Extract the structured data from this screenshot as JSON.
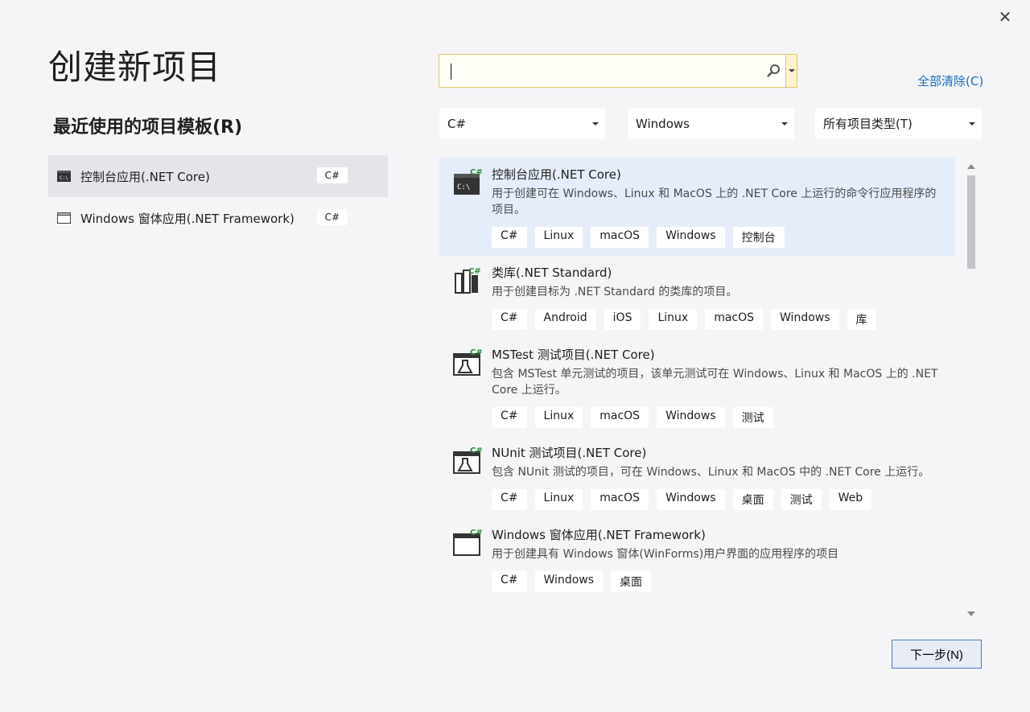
{
  "dialog": {
    "title": "创建新项目",
    "close_label": "✕"
  },
  "recent": {
    "title": "最近使用的项目模板(R)",
    "items": [
      {
        "label": "控制台应用(.NET Core)",
        "lang": "C#"
      },
      {
        "label": "Windows 窗体应用(.NET Framework)",
        "lang": "C#"
      }
    ]
  },
  "search": {
    "value": "",
    "placeholder": ""
  },
  "clear_all_label": "全部清除(C)",
  "filters": {
    "language": "C#",
    "platform": "Windows",
    "project_type": "所有项目类型(T)"
  },
  "templates": [
    {
      "name": "控制台应用(.NET Core)",
      "description": "用于创建可在 Windows、Linux 和 MacOS 上的 .NET Core 上运行的命令行应用程序的项目。",
      "tags": [
        "C#",
        "Linux",
        "macOS",
        "Windows",
        "控制台"
      ]
    },
    {
      "name": "类库(.NET Standard)",
      "description": "用于创建目标为 .NET Standard 的类库的项目。",
      "tags": [
        "C#",
        "Android",
        "iOS",
        "Linux",
        "macOS",
        "Windows",
        "库"
      ]
    },
    {
      "name": "MSTest 测试项目(.NET Core)",
      "description": "包含 MSTest 单元测试的项目，该单元测试可在 Windows、Linux 和 MacOS 上的 .NET Core 上运行。",
      "tags": [
        "C#",
        "Linux",
        "macOS",
        "Windows",
        "测试"
      ]
    },
    {
      "name": "NUnit 测试项目(.NET Core)",
      "description": "包含 NUnit 测试的项目，可在 Windows、Linux 和 MacOS 中的 .NET Core 上运行。",
      "tags": [
        "C#",
        "Linux",
        "macOS",
        "Windows",
        "桌面",
        "测试",
        "Web"
      ]
    },
    {
      "name": "Windows 窗体应用(.NET Framework)",
      "description": "用于创建具有 Windows 窗体(WinForms)用户界面的应用程序的项目",
      "tags": [
        "C#",
        "Windows",
        "桌面"
      ]
    }
  ],
  "next_button_label": "下一步(N)",
  "colors": {
    "accent": "#1a6fc2",
    "selected_template_bg": "#e5edfb",
    "search_border": "#e2c46b"
  }
}
